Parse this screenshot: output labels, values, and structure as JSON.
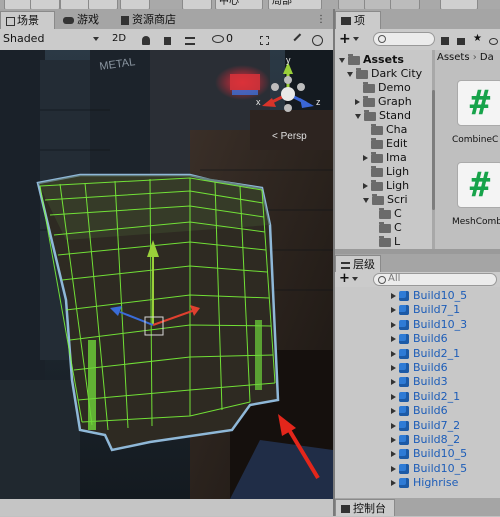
{
  "topbar": {
    "center_label": "中心",
    "local_label": "局部"
  },
  "scene": {
    "tabs": [
      {
        "label": "场景",
        "active": true
      },
      {
        "label": "游戏",
        "active": false
      },
      {
        "label": "资源商店",
        "active": false
      }
    ],
    "toolbar": {
      "shading_mode": "Shaded",
      "mode_2d": "2D",
      "gizmo_count": "0"
    },
    "gizmo": {
      "y_label": "y",
      "x_label": "x",
      "z_label": "z",
      "projection_label": "Persp"
    },
    "background_sign_text": "METAL"
  },
  "project": {
    "tab_label": "项目",
    "add_label": "+",
    "tree": [
      {
        "label": "Assets",
        "depth": 0,
        "open": true,
        "bold": true
      },
      {
        "label": "Dark City",
        "depth": 1,
        "open": true
      },
      {
        "label": "Demo",
        "depth": 2,
        "open": null
      },
      {
        "label": "Graph",
        "depth": 2,
        "open": false
      },
      {
        "label": "Stand",
        "depth": 2,
        "open": true
      },
      {
        "label": "Cha",
        "depth": 3,
        "open": null
      },
      {
        "label": "Edit",
        "depth": 3,
        "open": null
      },
      {
        "label": "Ima",
        "depth": 3,
        "open": false
      },
      {
        "label": "Ligh",
        "depth": 3,
        "open": null
      },
      {
        "label": "Ligh",
        "depth": 3,
        "open": false
      },
      {
        "label": "Scri",
        "depth": 3,
        "open": true
      },
      {
        "label": "C",
        "depth": 4,
        "open": null
      },
      {
        "label": "C",
        "depth": 4,
        "open": null
      },
      {
        "label": "L",
        "depth": 4,
        "open": null
      }
    ],
    "breadcrumb": "Assets",
    "breadcrumb_next": "Da",
    "files": [
      {
        "name": "CombineC",
        "icon": "#"
      },
      {
        "name": "MeshComb",
        "icon": "#"
      }
    ]
  },
  "hierarchy": {
    "tab_label": "层级",
    "add_label": "+",
    "search_placeholder": "All",
    "items": [
      "Build10_5",
      "Build7_1",
      "Build10_3",
      "Build6",
      "Build2_1",
      "Build6",
      "Build3",
      "Build2_1",
      "Build6",
      "Build7_2",
      "Build8_2",
      "Build10_5",
      "Build10_5",
      "Highrise"
    ]
  },
  "console": {
    "tab_label": "控制台"
  }
}
